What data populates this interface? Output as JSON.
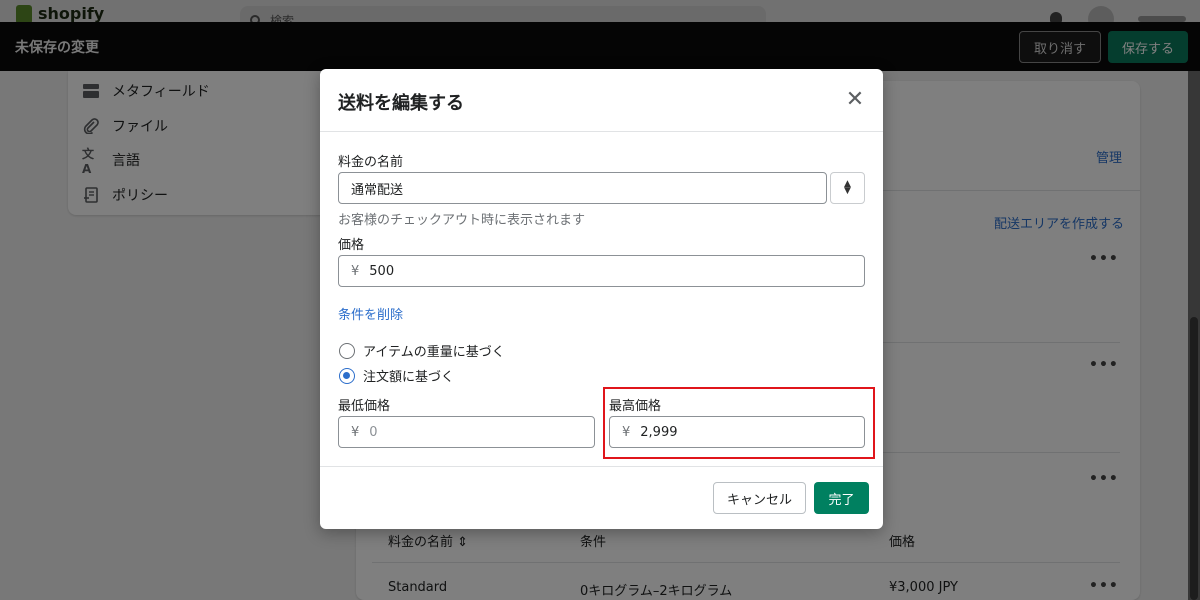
{
  "topbar": {
    "logo_text": "shopify",
    "search_placeholder": "検索"
  },
  "savebar": {
    "title": "未保存の変更",
    "discard_label": "取り消す",
    "save_label": "保存する"
  },
  "sidebar": {
    "items": [
      {
        "label": "メタフィールド",
        "icon": "metafield-icon"
      },
      {
        "label": "ファイル",
        "icon": "paperclip-icon"
      },
      {
        "label": "言語",
        "icon": "translate-icon"
      },
      {
        "label": "ポリシー",
        "icon": "policy-icon"
      }
    ]
  },
  "main": {
    "manage_link": "管理",
    "create_zone_link": "配送エリアを作成する",
    "more_label": "•••",
    "table": {
      "headers": [
        "料金の名前 ⇕",
        "条件",
        "価格"
      ],
      "rows": [
        {
          "name": "Standard",
          "condition": "0キログラム–2キログラム",
          "price": "¥3,000 JPY"
        }
      ]
    }
  },
  "modal": {
    "title": "送料を編集する",
    "close_icon": "close-icon",
    "rate_name_label": "料金の名前",
    "rate_name_value": "通常配送",
    "rate_name_help": "お客様のチェックアウト時に表示されます",
    "price_label": "価格",
    "currency_symbol": "¥",
    "price_value": "500",
    "remove_conditions_link": "条件を削除",
    "radio_weight_label": "アイテムの重量に基づく",
    "radio_price_label": "注文額に基づく",
    "selected_condition": "price",
    "min_price_label": "最低価格",
    "min_price_placeholder": "0",
    "max_price_label": "最高価格",
    "max_price_value": "2,999",
    "cancel_label": "キャンセル",
    "done_label": "完了"
  },
  "colors": {
    "primary_green": "#008060",
    "link_blue": "#2c6ecb",
    "highlight_red": "#e0151b",
    "savebar_bg": "#0a0a0b"
  }
}
